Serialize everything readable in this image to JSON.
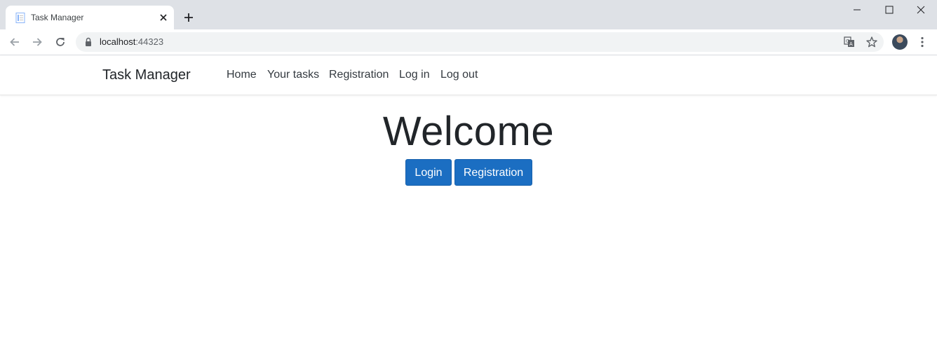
{
  "browser": {
    "tab_title": "Task Manager",
    "url_host": "localhost",
    "url_port": ":44323"
  },
  "site": {
    "brand": "Task Manager",
    "nav": [
      "Home",
      "Your tasks",
      "Registration",
      "Log in",
      "Log out"
    ]
  },
  "main": {
    "heading": "Welcome",
    "login_button": "Login",
    "registration_button": "Registration"
  },
  "colors": {
    "primary_button": "#1b6ec2",
    "tabstrip": "#dee1e6"
  },
  "icons": [
    "favicon-icon",
    "close-icon",
    "plus-icon",
    "minimize-icon",
    "maximize-icon",
    "back-icon",
    "forward-icon",
    "reload-icon",
    "lock-icon",
    "translate-icon",
    "star-icon",
    "avatar",
    "more-vert-icon"
  ]
}
